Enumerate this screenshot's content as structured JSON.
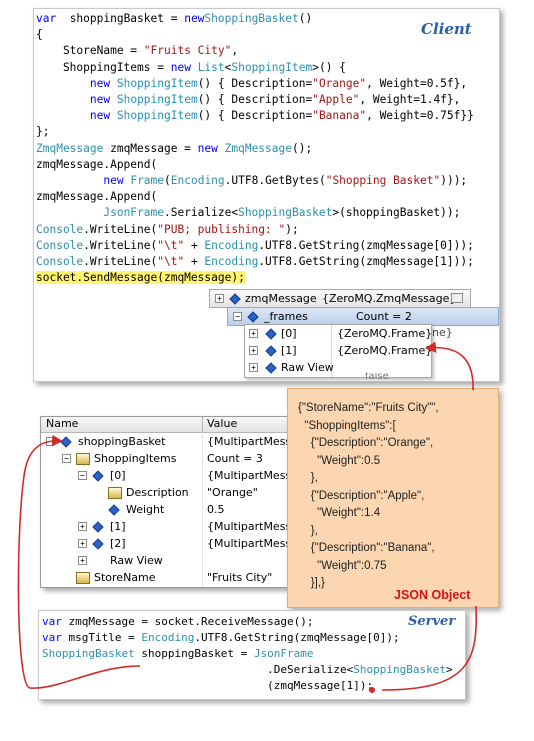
{
  "client": {
    "tag": "Client",
    "code_lines": [
      [
        [
          "kw",
          "var"
        ],
        [
          "",
          "  shoppingBasket = "
        ],
        [
          "kw",
          "new"
        ],
        [
          "",
          "",
          " "
        ],
        [
          "ty",
          "ShoppingBasket"
        ],
        [
          "",
          "()"
        ]
      ],
      [
        [
          "",
          "{"
        ]
      ],
      [
        [
          "",
          "    StoreName = "
        ],
        [
          "st",
          "\"Fruits City\""
        ],
        [
          "",
          ","
        ]
      ],
      [
        [
          "",
          "    ShoppingItems = "
        ],
        [
          "kw",
          "new"
        ],
        [
          "",
          " "
        ],
        [
          "ty",
          "List"
        ],
        [
          "",
          "<"
        ],
        [
          "ty",
          "ShoppingItem"
        ],
        [
          "",
          ">() {"
        ]
      ],
      [
        [
          "",
          "        "
        ],
        [
          "kw",
          "new"
        ],
        [
          "",
          " "
        ],
        [
          "ty",
          "ShoppingItem"
        ],
        [
          "",
          "() { Description="
        ],
        [
          "st",
          "\"Orange\""
        ],
        [
          "",
          ", Weight=0.5f},"
        ]
      ],
      [
        [
          "",
          "        "
        ],
        [
          "kw",
          "new"
        ],
        [
          "",
          " "
        ],
        [
          "ty",
          "ShoppingItem"
        ],
        [
          "",
          "() { Description="
        ],
        [
          "st",
          "\"Apple\""
        ],
        [
          "",
          ", Weight=1.4f},"
        ]
      ],
      [
        [
          "",
          "        "
        ],
        [
          "kw",
          "new"
        ],
        [
          "",
          " "
        ],
        [
          "ty",
          "ShoppingItem"
        ],
        [
          "",
          "() { Description="
        ],
        [
          "st",
          "\"Banana\""
        ],
        [
          "",
          ", Weight=0.75f}}"
        ]
      ],
      [
        [
          "",
          "};"
        ]
      ],
      [
        [
          "ty",
          "ZmqMessage"
        ],
        [
          "",
          " zmqMessage = "
        ],
        [
          "kw",
          "new"
        ],
        [
          "",
          " "
        ],
        [
          "ty",
          "ZmqMessage"
        ],
        [
          "",
          "();"
        ]
      ],
      [
        [
          "",
          "zmqMessage.Append("
        ]
      ],
      [
        [
          "",
          "          "
        ],
        [
          "kw",
          "new"
        ],
        [
          "",
          " "
        ],
        [
          "ty",
          "Frame"
        ],
        [
          "",
          "("
        ],
        [
          "ty",
          "Encoding"
        ],
        [
          "",
          ".UTF8.GetBytes("
        ],
        [
          "st",
          "\"Shopping Basket\""
        ],
        [
          "",
          ")));"
        ]
      ],
      [
        [
          "",
          "zmqMessage.Append("
        ]
      ],
      [
        [
          "",
          "          "
        ],
        [
          "ty",
          "JsonFrame"
        ],
        [
          "",
          ".Serialize<"
        ],
        [
          "ty",
          "ShoppingBasket"
        ],
        [
          "",
          ">(shoppingBasket));"
        ]
      ],
      [
        [
          "ty",
          "Console"
        ],
        [
          "",
          ".WriteLine("
        ],
        [
          "st",
          "\"PUB; publishing: \""
        ],
        [
          "",
          ");"
        ]
      ],
      [
        [
          "ty",
          "Console"
        ],
        [
          "",
          ".WriteLine("
        ],
        [
          "st",
          "\"\\t\""
        ],
        [
          "",
          " + "
        ],
        [
          "ty",
          "Encoding"
        ],
        [
          "",
          ".UTF8.GetString(zmqMessage[0]));"
        ]
      ],
      [
        [
          "ty",
          "Console"
        ],
        [
          "",
          ".WriteLine("
        ],
        [
          "st",
          "\"\\t\""
        ],
        [
          "",
          " + "
        ],
        [
          "ty",
          "Encoding"
        ],
        [
          "",
          ".UTF8.GetString(zmqMessage[1]));"
        ]
      ],
      [
        [
          "hl",
          "socket.SendMessage(zmqMessage);"
        ]
      ]
    ],
    "datatip": {
      "title_name": "zmqMessage",
      "title_value": "{ZeroMQ.ZmqMessage}",
      "frames_name": "_frames",
      "frames_value": "Count = 2",
      "rows": [
        {
          "name": "[0]",
          "value": "{ZeroMQ.Frame}"
        },
        {
          "name": "[1]",
          "value": "{ZeroMQ.Frame}"
        },
        {
          "name": "Raw View",
          "value": ""
        }
      ],
      "clipped_values": [
        "ne}",
        "false"
      ]
    }
  },
  "watch": {
    "col_name": "Name",
    "col_value": "Value",
    "rows": [
      {
        "name": "shoppingBasket",
        "value": "{MultipartMessa"
      },
      {
        "name": "ShoppingItems",
        "value": "Count = 3"
      },
      {
        "name": "[0]",
        "value": "{MultipartMessa"
      },
      {
        "name": "Description",
        "value": "\"Orange\""
      },
      {
        "name": "Weight",
        "value": "0.5"
      },
      {
        "name": "[1]",
        "value": "{MultipartMessa"
      },
      {
        "name": "[2]",
        "value": "{MultipartMessa"
      },
      {
        "name": "Raw View",
        "value": ""
      },
      {
        "name": "StoreName",
        "value": "\"Fruits City\""
      }
    ]
  },
  "json": {
    "lines": [
      "{\"StoreName\":\"Fruits City\"\",",
      "  \"ShoppingItems\":[",
      "    {\"Description\":\"Orange\",",
      "      \"Weight\":0.5",
      "    },",
      "    {\"Description\":\"Apple\",",
      "      \"Weight\":1.4",
      "    },",
      "    {\"Description\":\"Banana\",",
      "      \"Weight\":0.75",
      "    }],}"
    ],
    "label": "JSON Object"
  },
  "server": {
    "tag": "Server",
    "code_lines": [
      [
        [
          "kw",
          "var"
        ],
        [
          "",
          " zmqMessage = socket.ReceiveMessage();"
        ]
      ],
      [
        [
          "kw",
          "var"
        ],
        [
          "",
          " msgTitle = "
        ],
        [
          "ty",
          "Encoding"
        ],
        [
          "",
          ".UTF8.GetString(zmqMessage[0]);"
        ]
      ],
      [
        [
          "ty",
          "ShoppingBasket"
        ],
        [
          "",
          " shoppingBasket = "
        ],
        [
          "ty",
          "JsonFrame"
        ]
      ],
      [
        [
          "",
          "                                  .DeSerialize<"
        ],
        [
          "ty",
          "ShoppingBasket"
        ],
        [
          "",
          ">"
        ]
      ],
      [
        [
          "",
          "                                  (zmqMessage[1]"
        ],
        [
          "",
          ")"
        ],
        [
          "",
          ";"
        ]
      ]
    ]
  },
  "colors": {
    "keyword": "#0000ff",
    "type": "#2b91af",
    "string": "#a31515",
    "arrow": "#d22a2a",
    "json_bg": "#fbd6b0"
  }
}
